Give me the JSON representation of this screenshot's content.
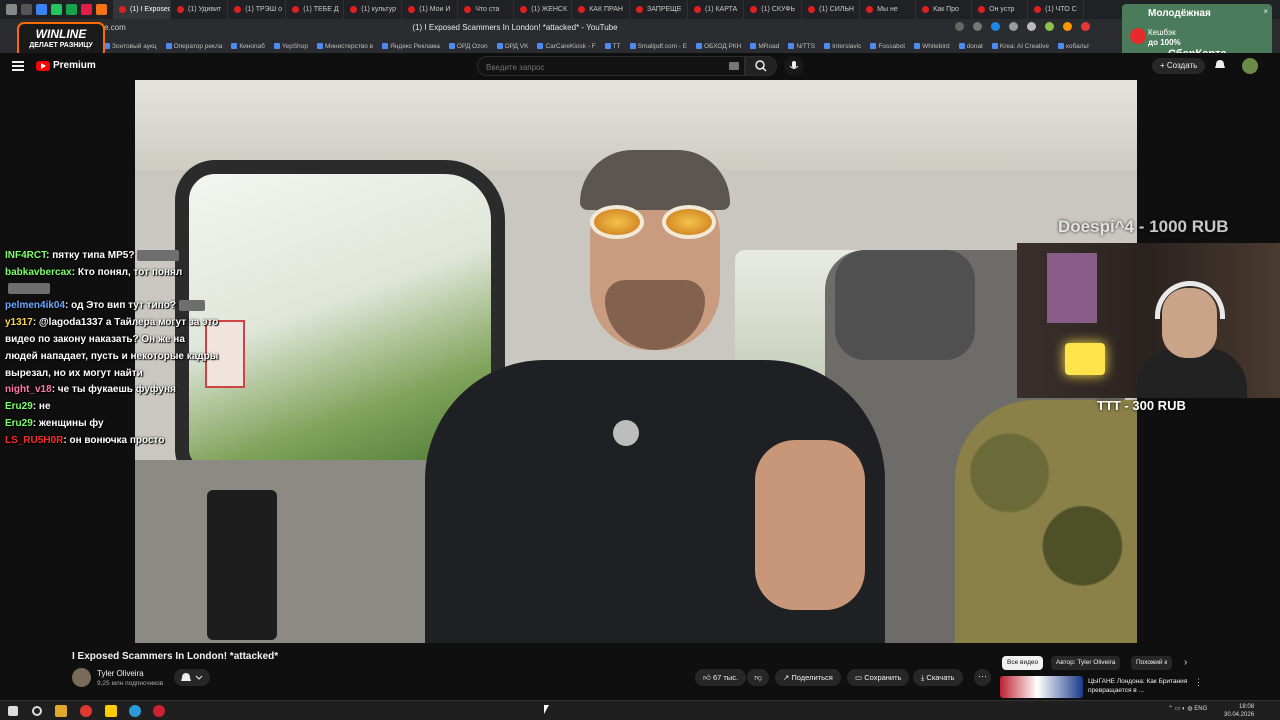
{
  "browser": {
    "tabs": [
      {
        "label": "(1) I Exposed",
        "active": true
      },
      {
        "label": "(1) Удивит"
      },
      {
        "label": "(1) ТРЭШ о"
      },
      {
        "label": "(1) ТЕБЕ Д"
      },
      {
        "label": "(1) культур"
      },
      {
        "label": "(1) Мои И"
      },
      {
        "label": "Что ста"
      },
      {
        "label": "(1) ЖЕНСК"
      },
      {
        "label": "КАК ПРАН"
      },
      {
        "label": "ЗАПРЕЩЕ"
      },
      {
        "label": "(1) КАРТА"
      },
      {
        "label": "(1) СКУФЬ"
      },
      {
        "label": "(1) СИЛЬН"
      },
      {
        "label": "Мы не"
      },
      {
        "label": "Как Про"
      },
      {
        "label": "Он устр"
      },
      {
        "label": "(1) ЧТО С"
      }
    ],
    "url": "e.com",
    "page_title": "(1) I Exposed Scammers In London! *attacked* - YouTube",
    "bookmarks": [
      "Зонтовый аукц",
      "Оператор рекла",
      "Кинопаб",
      "YepShop",
      "Министерство в",
      "Яндекс Реклама",
      "ОРД Ozon",
      "ОРД VK",
      "CarCareKiosk - F",
      "TT",
      "Smallpdf.com - E",
      "ОБХОД РКН",
      "MRoad",
      "N/TTS",
      "Interslavic",
      "Fossabot",
      "Whitebird",
      "donat",
      "Krea: AI Creative",
      "кобальт"
    ]
  },
  "ads": {
    "winline_title": "WINLINE",
    "winline_slogan": "ДЕЛАЕТ РАЗНИЦУ",
    "sber_line1": "Молодёжная",
    "sber_line2": "Кешбэк",
    "sber_line3": "до 100%",
    "sber_line4": "СберКарта",
    "sber_close": "×"
  },
  "youtube": {
    "logo_text": "Premium",
    "search_placeholder": "Введите запрос",
    "create_label": "+ Создать"
  },
  "stream": {
    "chat": [
      {
        "user": "INF4RCT",
        "text": "пятку типа MP5?",
        "color": "green",
        "emote": "wide"
      },
      {
        "user": "babkavbercax",
        "text": "Кто понял, тот понял",
        "color": "green",
        "emote": "wide"
      },
      {
        "user": "pelmen4ik04",
        "text": "од Это вип тут типо?",
        "color": "blue",
        "emote": "small"
      },
      {
        "user": "y1317",
        "text": "@lagoda1337 а Тайлера могут за это видео по закону наказать? Он же на людей нападает, пусть и некоторые кадры вырезал, но их могут найти",
        "color": "ylw"
      },
      {
        "user": "night_v18",
        "text": "че ты фукаешь фуфуня",
        "color": "pink"
      },
      {
        "user": "Eru29",
        "text": "не",
        "color": "green"
      },
      {
        "user": "Eru29",
        "text": "женщины фу",
        "color": "green"
      },
      {
        "user": "LS_RU5H0R",
        "text": "он вонючка просто",
        "color": "red"
      }
    ],
    "donation_top": "Doespi^4 - 1000 RUB",
    "donation_bottom": "TTT - 300 RUB"
  },
  "video": {
    "title": "I Exposed Scammers In London! *attacked*",
    "channel": "Tyler Oliveira",
    "subscribers": "9,25 млн подписчиков",
    "likes": "67 тыс.",
    "share_label": "Поделиться",
    "save_label": "Сохранить",
    "download_label": "Скачать",
    "more": "···"
  },
  "sidebar": {
    "chips": [
      "Все видео",
      "Автор: Tyler Oliveira",
      "Похожий к"
    ],
    "recommended_title": "ЦЫГАНЕ Лондона: Как Британия превращается в ..."
  },
  "taskbar": {
    "lang": "ENG",
    "time": "18:08",
    "date": "30.04.2026"
  }
}
